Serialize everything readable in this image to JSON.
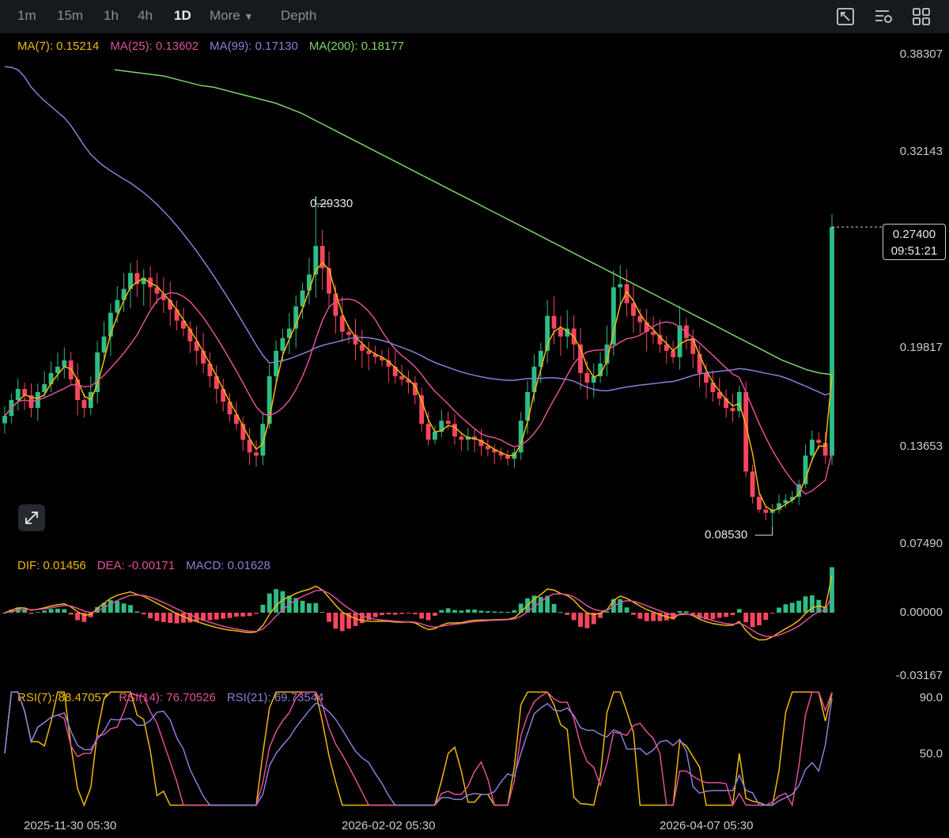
{
  "toolbar": {
    "timeframes": [
      "1m",
      "15m",
      "1h",
      "4h",
      "1D"
    ],
    "active": "1D",
    "more_label": "More",
    "depth_label": "Depth"
  },
  "legend": {
    "ma7": "MA(7): 0.15214",
    "ma25": "MA(25): 0.13602",
    "ma99": "MA(99): 0.17130",
    "ma200": "MA(200): 0.18177",
    "dif": "DIF: 0.01456",
    "dea": "DEA: -0.00171",
    "macd": "MACD: 0.01628",
    "rsi7": "RSI(7): 88.47057",
    "rsi14": "RSI(14): 76.70526",
    "rsi21": "RSI(21): 69.73544"
  },
  "colors": {
    "up": "#2ebd85",
    "down": "#f6465d",
    "ma7": "#f0b90b",
    "ma25": "#e0509a",
    "ma99": "#8b7fd6",
    "ma200": "#7ed36b"
  },
  "price_axis": [
    "0.38307",
    "0.32143",
    "0.19817",
    "0.13653",
    "0.07490"
  ],
  "macd_axis": [
    "0.00000",
    "-0.03167"
  ],
  "rsi_axis": [
    "90.0",
    "50.0"
  ],
  "dates": [
    "2025-11-30 05:30",
    "2026-02-02 05:30",
    "2026-04-07 05:30"
  ],
  "annotations": {
    "high": "0.29330",
    "low": "0.08530"
  },
  "current": {
    "price": "0.27400",
    "countdown": "09:51:21"
  },
  "chart_data": {
    "type": "candlestick",
    "price_range": [
      0.0749,
      0.38307
    ],
    "high": 0.2933,
    "low": 0.0853,
    "close": [
      0.155,
      0.165,
      0.172,
      0.168,
      0.16,
      0.17,
      0.175,
      0.182,
      0.186,
      0.19,
      0.178,
      0.165,
      0.16,
      0.17,
      0.195,
      0.205,
      0.22,
      0.228,
      0.235,
      0.245,
      0.238,
      0.242,
      0.236,
      0.232,
      0.228,
      0.222,
      0.215,
      0.21,
      0.202,
      0.196,
      0.188,
      0.18,
      0.172,
      0.164,
      0.156,
      0.15,
      0.14,
      0.132,
      0.13,
      0.15,
      0.18,
      0.196,
      0.204,
      0.21,
      0.224,
      0.234,
      0.244,
      0.262,
      0.248,
      0.232,
      0.218,
      0.208,
      0.206,
      0.2,
      0.196,
      0.194,
      0.192,
      0.19,
      0.186,
      0.18,
      0.178,
      0.176,
      0.168,
      0.15,
      0.14,
      0.145,
      0.152,
      0.15,
      0.142,
      0.14,
      0.142,
      0.14,
      0.136,
      0.134,
      0.132,
      0.13,
      0.128,
      0.132,
      0.152,
      0.17,
      0.186,
      0.196,
      0.218,
      0.21,
      0.205,
      0.21,
      0.2,
      0.182,
      0.176,
      0.18,
      0.188,
      0.2,
      0.236,
      0.238,
      0.226,
      0.218,
      0.214,
      0.208,
      0.206,
      0.2,
      0.196,
      0.192,
      0.212,
      0.204,
      0.194,
      0.182,
      0.176,
      0.17,
      0.166,
      0.16,
      0.158,
      0.17,
      0.12,
      0.104,
      0.096,
      0.094,
      0.096,
      0.1,
      0.102,
      0.104,
      0.112,
      0.13,
      0.14,
      0.138,
      0.13,
      0.274
    ],
    "ma200": [
      0.373,
      0.372,
      0.371,
      0.37,
      0.369,
      0.367,
      0.365,
      0.363,
      0.362,
      0.36,
      0.358,
      0.356,
      0.354,
      0.352,
      0.349,
      0.346,
      0.342,
      0.338,
      0.334,
      0.33,
      0.326,
      0.322,
      0.318,
      0.314,
      0.31,
      0.306,
      0.302,
      0.298,
      0.294,
      0.29,
      0.286,
      0.282,
      0.278,
      0.274,
      0.27,
      0.266,
      0.262,
      0.258,
      0.254,
      0.25,
      0.246,
      0.242,
      0.238,
      0.234,
      0.23,
      0.226,
      0.222,
      0.218,
      0.214,
      0.21,
      0.206,
      0.202,
      0.198,
      0.194,
      0.19,
      0.187,
      0.184,
      0.182,
      0.181
    ],
    "macd_range": [
      -0.03167,
      0.02
    ]
  }
}
